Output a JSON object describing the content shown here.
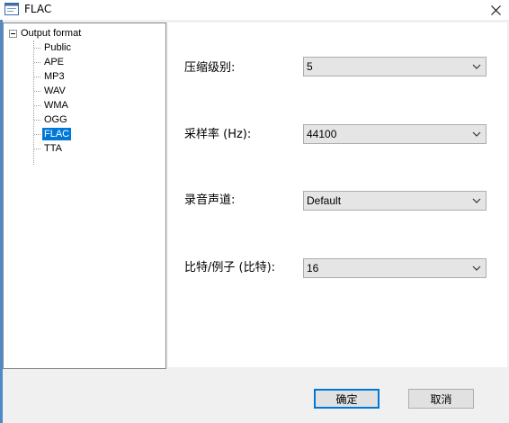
{
  "window": {
    "title": "FLAC",
    "accent_color": "#0078d7"
  },
  "tree": {
    "root_label": "Output format",
    "items": [
      {
        "label": "Public",
        "selected": false
      },
      {
        "label": "APE",
        "selected": false
      },
      {
        "label": "MP3",
        "selected": false
      },
      {
        "label": "WAV",
        "selected": false
      },
      {
        "label": "WMA",
        "selected": false
      },
      {
        "label": "OGG",
        "selected": false
      },
      {
        "label": "FLAC",
        "selected": true
      },
      {
        "label": "TTA",
        "selected": false
      }
    ]
  },
  "settings": {
    "compression": {
      "label": "压缩级别:",
      "value": "5"
    },
    "sample_rate": {
      "label": "采样率 (Hz):",
      "value": "44100"
    },
    "channels": {
      "label": "录音声道:",
      "value": "Default"
    },
    "bits": {
      "label": "比特/例子 (比特):",
      "value": "16"
    }
  },
  "buttons": {
    "ok": "确定",
    "cancel": "取消"
  },
  "icons": {
    "app": "app-window-icon",
    "close": "close-icon",
    "dropdown": "chevron-down-icon",
    "tree_toggle": "tree-collapse-icon"
  }
}
